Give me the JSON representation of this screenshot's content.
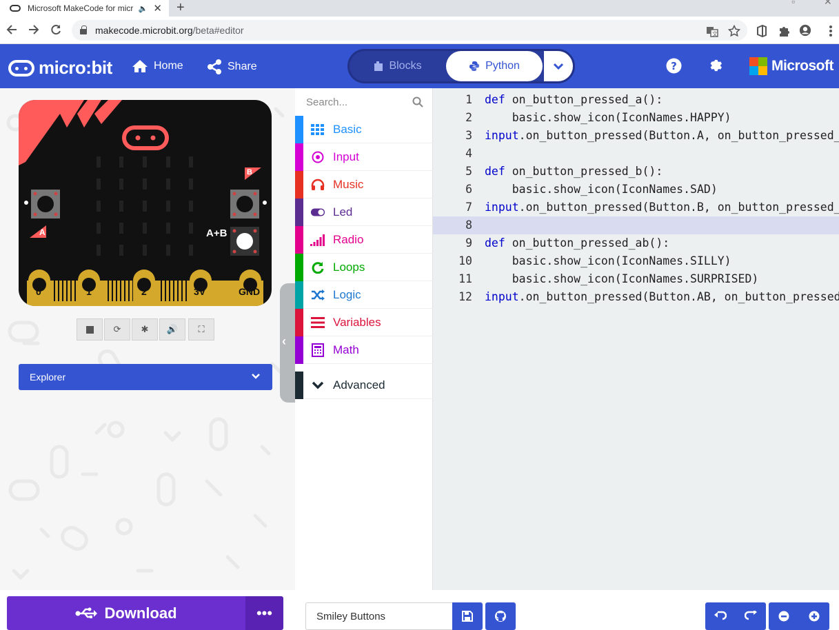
{
  "browser": {
    "tab_title": "Microsoft MakeCode for micro:bit",
    "tab_audio_icon": "speaker-icon",
    "new_tab": "+",
    "url_domain": "makecode.microbit.org",
    "url_path": "/beta#editor"
  },
  "header": {
    "brand": "micro:bit",
    "home_label": "Home",
    "share_label": "Share",
    "blocks_label": "Blocks",
    "python_label": "Python",
    "microsoft_label": "Microsoft",
    "brand_color": "#3454d1"
  },
  "simulator": {
    "pin_labels": [
      "0",
      "1",
      "2",
      "3V",
      "GND"
    ],
    "button_a": "A",
    "button_b": "B",
    "button_ab": "A+B"
  },
  "explorer": {
    "label": "Explorer"
  },
  "toolbox": {
    "search_placeholder": "Search...",
    "categories": [
      {
        "label": "Basic",
        "color": "#1e90ff",
        "icon": "grid-icon"
      },
      {
        "label": "Input",
        "color": "#d400d4",
        "icon": "target-icon"
      },
      {
        "label": "Music",
        "color": "#e63022",
        "icon": "headphones-icon"
      },
      {
        "label": "Led",
        "color": "#5c2d91",
        "icon": "toggle-icon"
      },
      {
        "label": "Radio",
        "color": "#e3008c",
        "icon": "signal-bars-icon"
      },
      {
        "label": "Loops",
        "color": "#00aa00",
        "icon": "refresh-icon"
      },
      {
        "label": "Logic",
        "color": "#00a4a6",
        "icon": "shuffle-icon"
      },
      {
        "label": "Variables",
        "color": "#dc143c",
        "icon": "list-icon"
      },
      {
        "label": "Math",
        "color": "#9400d3",
        "icon": "calculator-icon"
      }
    ],
    "advanced_label": "Advanced"
  },
  "editor": {
    "lines": [
      {
        "n": "1",
        "kw": "def",
        "text": " on_button_pressed_a():"
      },
      {
        "n": "2",
        "kw": "",
        "text": "    basic.show_icon(IconNames.HAPPY)"
      },
      {
        "n": "3",
        "inp": "input",
        "text": ".on_button_pressed(Button.A, on_button_pressed_a)"
      },
      {
        "n": "4",
        "text": ""
      },
      {
        "n": "5",
        "kw": "def",
        "text": " on_button_pressed_b():"
      },
      {
        "n": "6",
        "text": "    basic.show_icon(IconNames.SAD)"
      },
      {
        "n": "7",
        "inp": "input",
        "text": ".on_button_pressed(Button.B, on_button_pressed_b)"
      },
      {
        "n": "8",
        "text": ""
      },
      {
        "n": "9",
        "kw": "def",
        "text": " on_button_pressed_ab():"
      },
      {
        "n": "10",
        "text": "    basic.show_icon(IconNames.SILLY)"
      },
      {
        "n": "11",
        "text": "    basic.show_icon(IconNames.SURPRISED)"
      },
      {
        "n": "12",
        "inp": "input",
        "text": ".on_button_pressed(Button.AB, on_button_pressed_ab)"
      }
    ],
    "highlighted_line": 8
  },
  "footer": {
    "download_label": "Download",
    "more_label": "•••",
    "project_name": "Smiley Buttons"
  }
}
